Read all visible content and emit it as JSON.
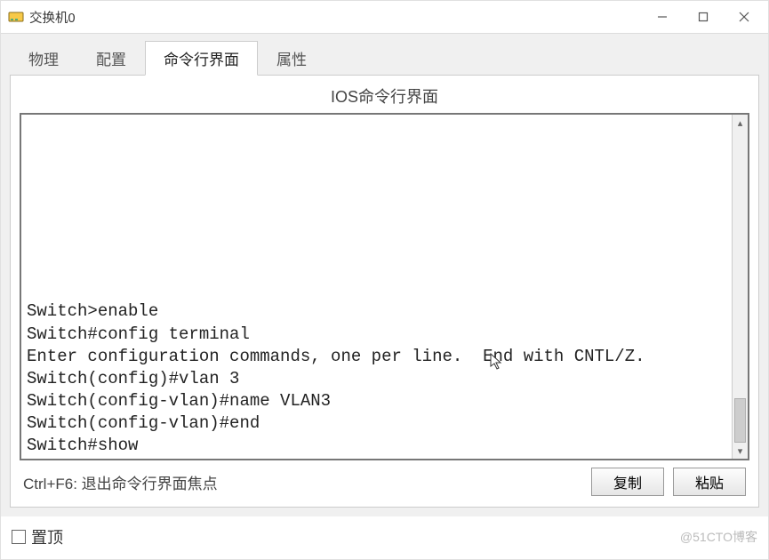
{
  "window": {
    "title": "交换机0"
  },
  "tabs": [
    {
      "label": "物理",
      "active": false
    },
    {
      "label": "配置",
      "active": false
    },
    {
      "label": "命令行界面",
      "active": true
    },
    {
      "label": "属性",
      "active": false
    }
  ],
  "section_title": "IOS命令行界面",
  "terminal_lines": [
    "Switch>enable",
    "Switch#config terminal",
    "Enter configuration commands, one per line.  End with CNTL/Z.",
    "Switch(config)#vlan 3",
    "Switch(config-vlan)#name VLAN3",
    "Switch(config-vlan)#end",
    "Switch#show"
  ],
  "hint": "Ctrl+F6: 退出命令行界面焦点",
  "buttons": {
    "copy": "复制",
    "paste": "粘贴"
  },
  "footer": {
    "on_top": "置顶"
  },
  "watermark": "@51CTO博客"
}
